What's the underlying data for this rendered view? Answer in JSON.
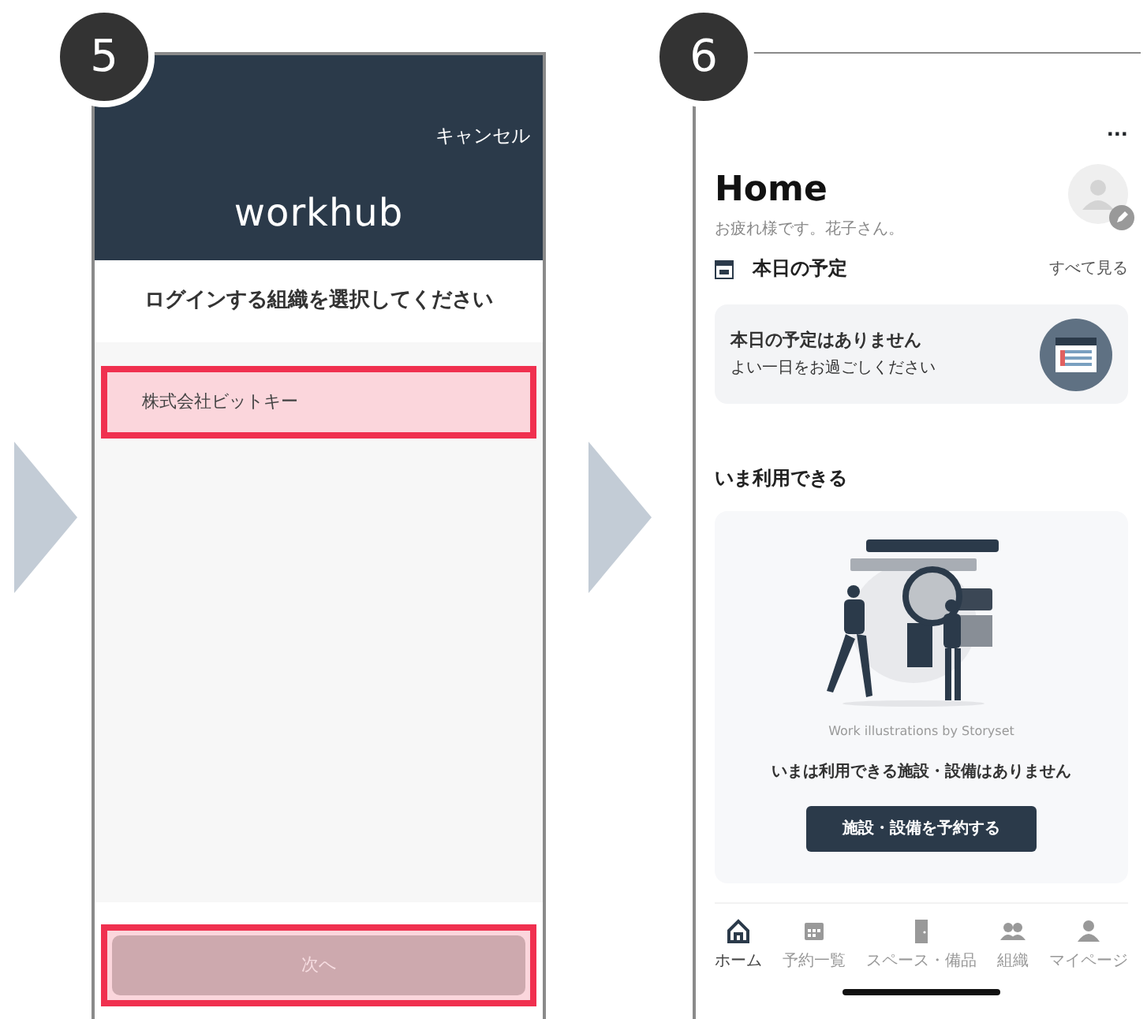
{
  "left_screen": {
    "step": "5",
    "cancel": "キャンセル",
    "logo": "workhub",
    "title": "ログインする組織を選択してください",
    "organizations": [
      {
        "name": "株式会社ビットキー",
        "selected": true,
        "highlighted": true
      }
    ],
    "next_button": {
      "label": "次へ",
      "disabled": true,
      "highlighted": true
    }
  },
  "right_screen": {
    "step": "6",
    "more": "...",
    "heading": "Home",
    "greeting": "お疲れ様です。花子さん。",
    "schedule": {
      "title": "本日の予定",
      "see_all": "すべて見る",
      "empty_title": "本日の予定はありません",
      "empty_text": "よい一日をお過ごしください"
    },
    "available": {
      "title": "いま利用できる",
      "credit": "Work illustrations by Storyset",
      "empty_text": "いまは利用できる施設・設備はありません",
      "button": "施設・設備を予約する"
    },
    "tabs": [
      {
        "label": "ホーム",
        "kind": "home",
        "selected": true
      },
      {
        "label": "予約一覧",
        "kind": "calendar",
        "selected": false
      },
      {
        "label": "スペース・備品",
        "kind": "door",
        "selected": false
      },
      {
        "label": "組織",
        "kind": "group",
        "selected": false
      },
      {
        "label": "マイページ",
        "kind": "person",
        "selected": false
      }
    ]
  }
}
